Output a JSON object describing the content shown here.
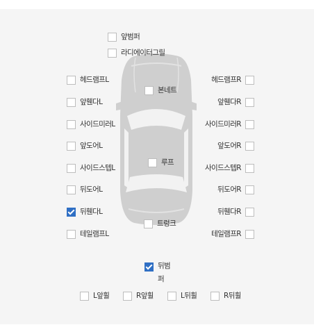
{
  "colors": {
    "panel_bg": "#f5f5f5",
    "car_fill": "#cfcfcf",
    "check_accent": "#2f6fc4"
  },
  "options": {
    "front_bumper": {
      "label": "앞범퍼",
      "checked": false
    },
    "radiator_grill": {
      "label": "라디에이터그릴",
      "checked": false
    },
    "headlamp_l": {
      "label": "헤드램프L",
      "checked": false
    },
    "headlamp_r": {
      "label": "헤드램프R",
      "checked": false
    },
    "bonnet": {
      "label": "본네트",
      "checked": false
    },
    "front_fender_l": {
      "label": "앞휀다L",
      "checked": false
    },
    "front_fender_r": {
      "label": "앞휀다R",
      "checked": false
    },
    "side_mirror_l": {
      "label": "사이드미러L",
      "checked": false
    },
    "side_mirror_r": {
      "label": "사이드미러R",
      "checked": false
    },
    "front_door_l": {
      "label": "앞도어L",
      "checked": false
    },
    "front_door_r": {
      "label": "앞도어R",
      "checked": false
    },
    "roof": {
      "label": "루프",
      "checked": false
    },
    "side_step_l": {
      "label": "사이드스텝L",
      "checked": false
    },
    "side_step_r": {
      "label": "사이드스텝R",
      "checked": false
    },
    "rear_door_l": {
      "label": "뒤도어L",
      "checked": false
    },
    "rear_door_r": {
      "label": "뒤도어R",
      "checked": false
    },
    "rear_fender_l": {
      "label": "뒤휀다L",
      "checked": true
    },
    "rear_fender_r": {
      "label": "뒤휀다R",
      "checked": false
    },
    "trunk": {
      "label": "트렁크",
      "checked": false
    },
    "taillamp_l": {
      "label": "테일램프L",
      "checked": false
    },
    "taillamp_r": {
      "label": "테일램프R",
      "checked": false
    },
    "rear_bumper": {
      "label": "뒤범퍼",
      "checked": true
    },
    "wheel_front_l": {
      "label": "L앞휠",
      "checked": false
    },
    "wheel_front_r": {
      "label": "R앞휠",
      "checked": false
    },
    "wheel_rear_l": {
      "label": "L뒤휠",
      "checked": false
    },
    "wheel_rear_r": {
      "label": "R뒤휠",
      "checked": false
    }
  }
}
